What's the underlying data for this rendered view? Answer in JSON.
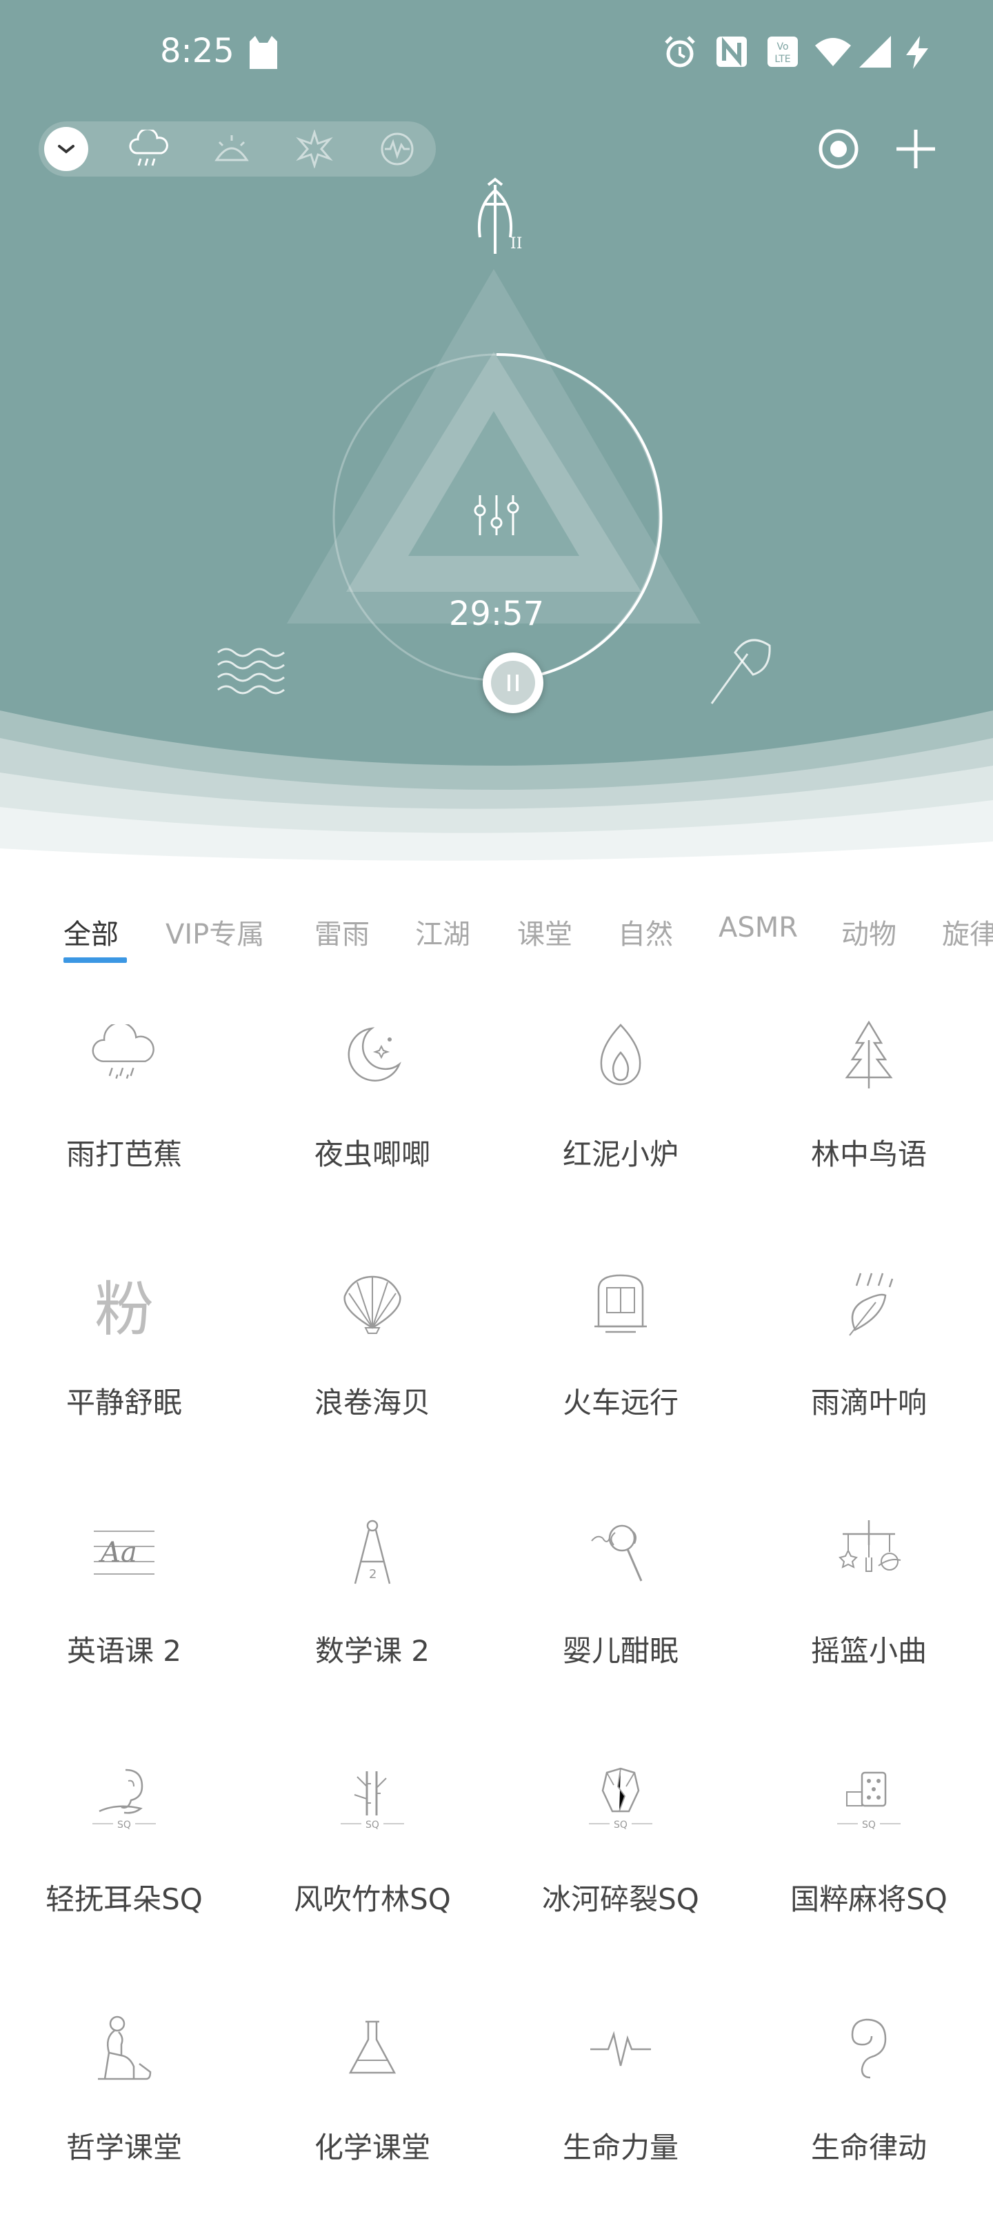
{
  "status_bar": {
    "time": "8:25"
  },
  "player": {
    "remaining_time": "29:57"
  },
  "tabs": [
    {
      "label": "全部"
    },
    {
      "label": "VIP专属"
    },
    {
      "label": "雷雨"
    },
    {
      "label": "江湖"
    },
    {
      "label": "课堂"
    },
    {
      "label": "自然"
    },
    {
      "label": "ASMR"
    },
    {
      "label": "动物"
    },
    {
      "label": "旋律"
    }
  ],
  "sounds": [
    {
      "label": "雨打芭蕉",
      "icon": "rain-cloud-icon"
    },
    {
      "label": "夜虫唧唧",
      "icon": "moon-stars-icon"
    },
    {
      "label": "红泥小炉",
      "icon": "flame-icon"
    },
    {
      "label": "林中鸟语",
      "icon": "pine-tree-icon"
    },
    {
      "label": "平静舒眠",
      "icon": "fen-character-icon",
      "glyph": "粉"
    },
    {
      "label": "浪卷海贝",
      "icon": "seashell-icon"
    },
    {
      "label": "火车远行",
      "icon": "train-icon"
    },
    {
      "label": "雨滴叶响",
      "icon": "rain-leaf-icon"
    },
    {
      "label": "英语课 2",
      "icon": "english-lesson-icon",
      "glyph": "Aa"
    },
    {
      "label": "数学课 2",
      "icon": "compass-icon"
    },
    {
      "label": "婴儿酣眠",
      "icon": "rattle-icon"
    },
    {
      "label": "摇篮小曲",
      "icon": "mobile-toy-icon"
    },
    {
      "label": "轻抚耳朵SQ",
      "icon": "ear-hand-icon"
    },
    {
      "label": "风吹竹林SQ",
      "icon": "bamboo-icon"
    },
    {
      "label": "冰河碎裂SQ",
      "icon": "glacier-icon"
    },
    {
      "label": "国粹麻将SQ",
      "icon": "mahjong-icon"
    },
    {
      "label": "哲学课堂",
      "icon": "thinker-icon"
    },
    {
      "label": "化学课堂",
      "icon": "flask-icon"
    },
    {
      "label": "生命力量",
      "icon": "heartbeat-icon"
    },
    {
      "label": "生命律动",
      "icon": "embryo-icon"
    }
  ],
  "colors": {
    "hero_bg": "#7ea4a2",
    "tab_active_underline": "#3b97e3",
    "label_text": "#444444",
    "tab_inactive": "#a8a8a8"
  }
}
